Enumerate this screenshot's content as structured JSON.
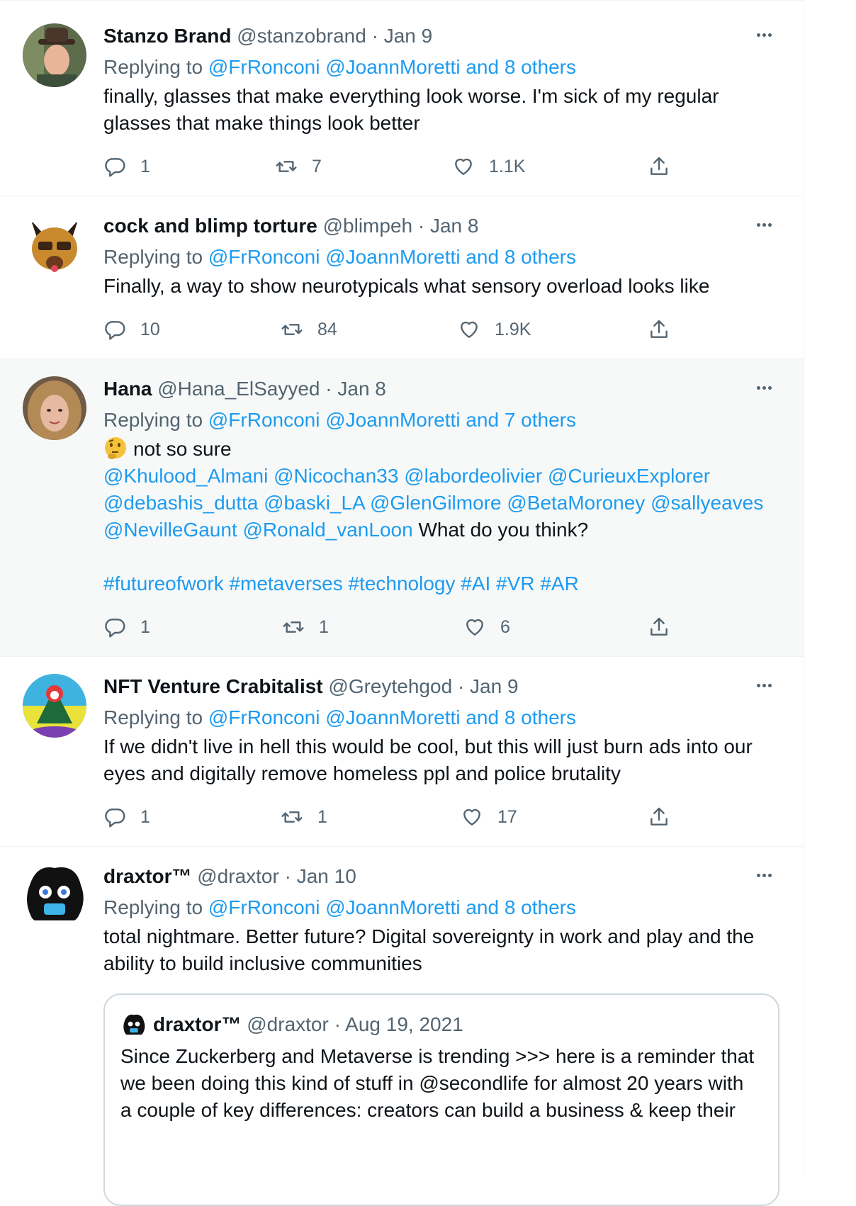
{
  "tweets": [
    {
      "name": "Stanzo Brand",
      "handle": "@stanzobrand",
      "sep": "·",
      "date": "Jan 9",
      "replying_prefix": "Replying to",
      "reply_users": [
        "@FrRonconi",
        "@JoannMoretti"
      ],
      "reply_others": "and 8 others",
      "text_lines": [
        "finally, glasses that make everything look worse. I'm sick of my regular",
        "glasses that make things look better"
      ],
      "reply_count": "1",
      "retweet_count": "7",
      "like_count": "1.1K"
    },
    {
      "name": "cock and blimp torture",
      "handle": "@blimpeh",
      "sep": "·",
      "date": "Jan 8",
      "replying_prefix": "Replying to",
      "reply_users": [
        "@FrRonconi",
        "@JoannMoretti"
      ],
      "reply_others": "and 8 others",
      "text_lines": [
        "Finally, a way to show neurotypicals what sensory overload looks like"
      ],
      "reply_count": "10",
      "retweet_count": "84",
      "like_count": "1.9K"
    },
    {
      "name": "Hana",
      "handle": "@Hana_ElSayyed",
      "sep": "·",
      "date": "Jan 8",
      "replying_prefix": "Replying to",
      "reply_users": [
        "@FrRonconi",
        "@JoannMoretti"
      ],
      "reply_others": "and 7 others",
      "text_first": "not so sure",
      "mentions_line1": "@Khulood_Almani @Nicochan33 @labordeolivier @CurieuxExplorer",
      "mentions_line2": "@debashis_dutta @baski_LA @GlenGilmore @BetaMoroney @sallyeaves",
      "mentions_line3": "@NevilleGaunt @Ronald_vanLoon",
      "text_after_mentions": "What do you think?",
      "hashtags": "#futureofwork #metaverses #technology #AI #VR #AR",
      "reply_count": "1",
      "retweet_count": "1",
      "like_count": "6"
    },
    {
      "name": "NFT Venture Crabitalist",
      "handle": "@Greytehgod",
      "sep": "·",
      "date": "Jan 9",
      "replying_prefix": "Replying to",
      "reply_users": [
        "@FrRonconi",
        "@JoannMoretti"
      ],
      "reply_others": "and 8 others",
      "text_lines": [
        "If we didn't live in hell this would be cool, but this will just burn ads into our",
        "eyes and digitally remove homeless ppl and police brutality"
      ],
      "reply_count": "1",
      "retweet_count": "1",
      "like_count": "17"
    },
    {
      "name": "draxtor™",
      "handle": "@draxtor",
      "sep": "·",
      "date": "Jan 10",
      "replying_prefix": "Replying to",
      "reply_users": [
        "@FrRonconi",
        "@JoannMoretti"
      ],
      "reply_others": "and 8 others",
      "text_lines": [
        "total nightmare. Better future? Digital sovereignty in work and play and the",
        "ability to build inclusive communities"
      ]
    }
  ],
  "quote": {
    "name": "draxtor™",
    "handle": "@draxtor",
    "sep": "·",
    "date": "Aug 19, 2021",
    "text_lines": [
      "Since Zuckerberg and Metaverse is trending >>> here is a reminder that",
      "we been doing this kind of stuff in @secondlife for almost 20 years with",
      "a couple of key differences: creators can build a business & keep their"
    ]
  },
  "icons": {
    "reply": "reply-icon",
    "retweet": "retweet-icon",
    "like": "like-icon",
    "share": "share-icon",
    "more": "more-icon"
  },
  "colors": {
    "link": "#1d9bf0",
    "muted": "#536471",
    "text": "#0f1419",
    "highlight_bg": "#f7f9f9"
  }
}
